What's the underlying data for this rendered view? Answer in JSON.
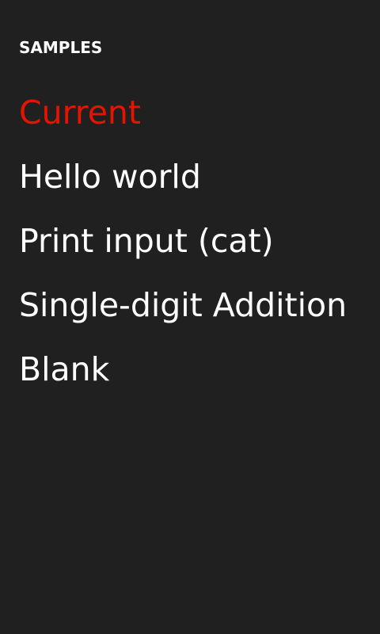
{
  "header": {
    "title": "SAMPLES"
  },
  "samples": {
    "items": [
      {
        "label": "Current",
        "selected": true
      },
      {
        "label": "Hello world",
        "selected": false
      },
      {
        "label": "Print input (cat)",
        "selected": false
      },
      {
        "label": "Single-digit Addition",
        "selected": false
      },
      {
        "label": "Blank",
        "selected": false
      }
    ]
  },
  "colors": {
    "background": "#202020",
    "text": "#ffffff",
    "accent": "#e51400"
  }
}
